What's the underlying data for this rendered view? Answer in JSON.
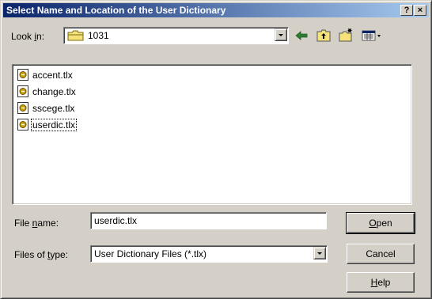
{
  "window": {
    "title": "Select Name and Location of the User Dictionary",
    "help_glyph": "?",
    "close_glyph": "×"
  },
  "lookin": {
    "label_prefix": "Look ",
    "label_accel": "i",
    "label_suffix": "n:",
    "value": "1031"
  },
  "toolbar": {
    "icons": [
      "back-icon",
      "up-folder-icon",
      "new-folder-icon",
      "views-menu-icon"
    ]
  },
  "files": [
    {
      "name": "accent.tlx"
    },
    {
      "name": "change.tlx"
    },
    {
      "name": "sscege.tlx"
    },
    {
      "name": "userdic.tlx"
    }
  ],
  "filename": {
    "label_prefix": "File ",
    "label_accel": "n",
    "label_suffix": "ame:",
    "value": "userdic.tlx"
  },
  "filetype": {
    "label_prefix": "Files of ",
    "label_accel": "t",
    "label_suffix": "ype:",
    "value": "User Dictionary Files (*.tlx)"
  },
  "buttons": {
    "open_accel": "O",
    "open_rest": "pen",
    "cancel": "Cancel",
    "help_accel": "H",
    "help_rest": "elp"
  },
  "colors": {
    "title_start": "#0a246a",
    "title_end": "#a6caf0",
    "face": "#d4d0c8",
    "folder": "#f6e27a"
  }
}
